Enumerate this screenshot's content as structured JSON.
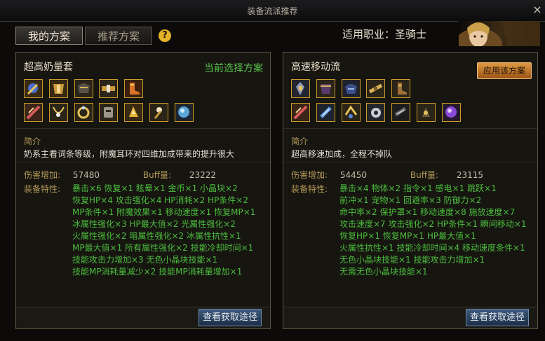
{
  "window": {
    "title": "装备流派推荐",
    "close": "×"
  },
  "tabs": {
    "mine": "我的方案",
    "recommend": "推荐方案"
  },
  "help": "?",
  "job": "适用职业：圣骑士",
  "panels": [
    {
      "title": "超高奶量套",
      "status": "当前选择方案",
      "intro_label": "简介",
      "intro": "奶系主看词条等级，附魔耳环对四维加成带来的提升很大",
      "dmg_label": "伤害增加:",
      "dmg": "57480",
      "buff_label": "Buff量:",
      "buff": "23222",
      "attr_label": "装备特性:",
      "attrs": [
        "暴击×6  恢复×1  眩晕×1  金币×1  小晶块×2",
        "恢复HP×4  攻击强化×4  HP消耗×2  HP条件×2",
        "MP条件×1  附魔效果×1  移动速度×1  恢复MP×1",
        "冰属性强化×3  HP最大值×2  光属性强化×2",
        "火属性强化×2  暗属性强化×2  冰属性抗性×1",
        "MP最大值×1  所有属性强化×2  技能冷却时间×1",
        "技能攻击力增加×3  无色小晶块技能×1",
        "技能MP消耗量减少×2  技能MP消耗量增加×1"
      ],
      "button": "查看获取途径"
    },
    {
      "title": "高速移动流",
      "apply": "应用该方案",
      "intro_label": "简介",
      "intro": "超高移速加成，全程不掉队",
      "dmg_label": "伤害增加:",
      "dmg": "54450",
      "buff_label": "Buff量:",
      "buff": "23115",
      "attr_label": "装备特性:",
      "attrs": [
        "暴击×4  物体×2  指令×1  感电×1  跳跃×1",
        "前冲×1  宠物×1  回避率×3  防御力×2",
        "命中率×2  保护罩×1  移动速度×8  施放速度×7",
        "攻击速度×7  攻击强化×2  HP条件×1  瞬间移动×1",
        "恢复HP×1  恢复MP×1  HP最大值×1",
        "火属性抗性×1  技能冷却时间×4  移动速度条件×1",
        "无色小晶块技能×1  技能攻击力增加×1",
        "无需无色小晶块技能×1"
      ],
      "button": "查看获取途径"
    }
  ],
  "colors": {
    "gold_border": "#c99b2a",
    "green_text": "#4cbd3d",
    "accent_orange": "#e09a42"
  }
}
